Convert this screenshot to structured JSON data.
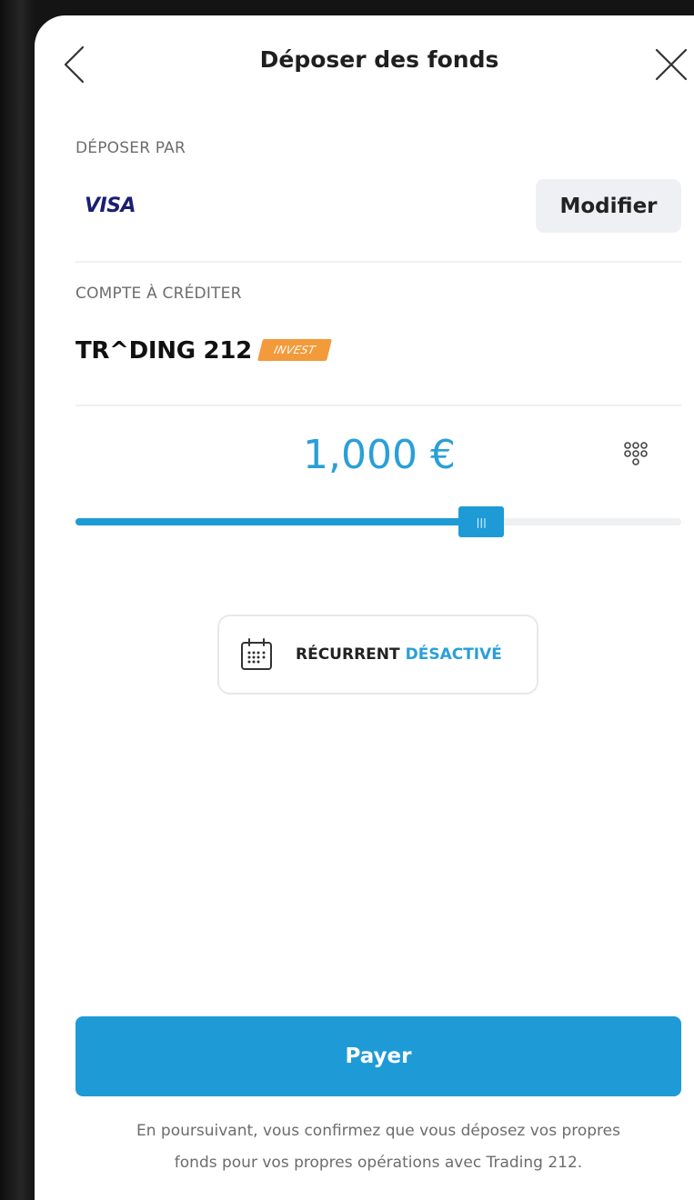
{
  "header": {
    "title": "Déposer des fonds",
    "back_icon": "chevron-left-icon",
    "close_icon": "close-icon"
  },
  "deposit_method": {
    "label": "DÉPOSER PAR",
    "card_brand": "VISA",
    "modify_label": "Modifier"
  },
  "target_account": {
    "label": "COMPTE À CRÉDITER",
    "brand": "TR^DING 212",
    "badge": "INVEST"
  },
  "amount": {
    "value": "1,000 €",
    "keypad_icon": "keypad-icon",
    "slider_level": 0.67
  },
  "recurring": {
    "icon": "calendar-icon",
    "label": "RÉCURRENT",
    "state": "DÉSACTIVÉ"
  },
  "pay_button": {
    "label": "Payer"
  },
  "disclaimer": {
    "line1": "En poursuivant, vous confirmez que vous déposez vos propres",
    "line2": "fonds pour vos propres opérations avec Trading 212."
  },
  "colors": {
    "accent": "#1e9bd7",
    "amount_text": "#2a9fd8",
    "invest_badge": "#f39a3a",
    "visa_blue": "#1a1f71"
  }
}
